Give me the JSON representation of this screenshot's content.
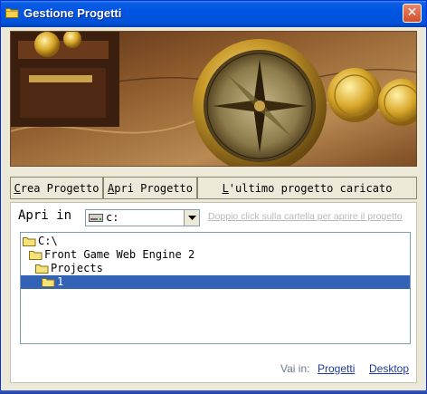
{
  "window": {
    "title": "Gestione Progetti",
    "close_glyph": "✕",
    "accent": "#0054e3"
  },
  "toolbar": {
    "crea_hotkey": "C",
    "crea_rest": "rea Progetto",
    "apri_hotkey": "A",
    "apri_rest": "pri Progetto",
    "ultimo_hotkey": "L",
    "ultimo_rest": "'ultimo progetto caricato"
  },
  "browser": {
    "apri_in_label": "Apri in",
    "drive_value": "c:",
    "hint": "Doppio click sulla cartella per aprire il progetto",
    "tree": [
      {
        "label": "C:\\",
        "selected": false
      },
      {
        "label": "Front Game Web Engine 2",
        "selected": false
      },
      {
        "label": "Projects",
        "selected": false
      },
      {
        "label": "1",
        "selected": true
      }
    ],
    "selection_color": "#3162b5"
  },
  "footer": {
    "vai_in_label": "Vai in:",
    "link_progetti": "Progetti",
    "link_desktop": "Desktop"
  },
  "icons": {
    "title": "folder-icon",
    "drive": "drive-icon",
    "tree_items": "folder-icon"
  }
}
